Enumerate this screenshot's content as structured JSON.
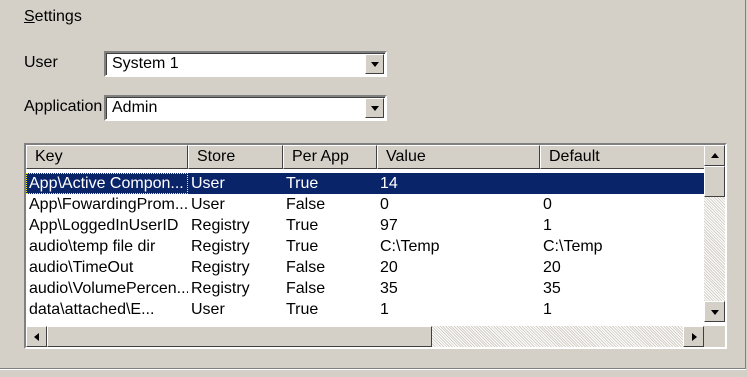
{
  "settings": {
    "title_prefix": "S",
    "title_rest": "ettings"
  },
  "user": {
    "label": "User",
    "value": "System 1"
  },
  "application": {
    "label": "Application",
    "value": "Admin"
  },
  "table": {
    "columns": [
      "Key",
      "Store",
      "Per App",
      "Value",
      "Default"
    ],
    "rows": [
      [
        "App\\Active Compon...",
        "User",
        "True",
        "14",
        ""
      ],
      [
        "App\\FowardingProm...",
        "User",
        "False",
        "0",
        "0"
      ],
      [
        "App\\LoggedInUserID",
        "Registry",
        "True",
        "97",
        "1"
      ],
      [
        "audio\\temp file dir",
        "Registry",
        "True",
        "C:\\Temp",
        "C:\\Temp"
      ],
      [
        "audio\\TimeOut",
        "Registry",
        "False",
        "20",
        "20"
      ],
      [
        "audio\\VolumePercen...",
        "Registry",
        "False",
        "35",
        "35"
      ],
      [
        "data\\attached\\E...",
        "User",
        "True",
        "1",
        "1"
      ]
    ],
    "selected_row": 0
  },
  "icons": {
    "dropdown": "chevron-down-icon",
    "scroll_up": "scroll-up-arrow-icon",
    "scroll_down": "scroll-down-arrow-icon",
    "scroll_left": "scroll-left-arrow-icon",
    "scroll_right": "scroll-right-arrow-icon"
  },
  "colors": {
    "background": "#d4d0c8",
    "selection": "#0a246a",
    "selection_text": "#ffffff"
  }
}
